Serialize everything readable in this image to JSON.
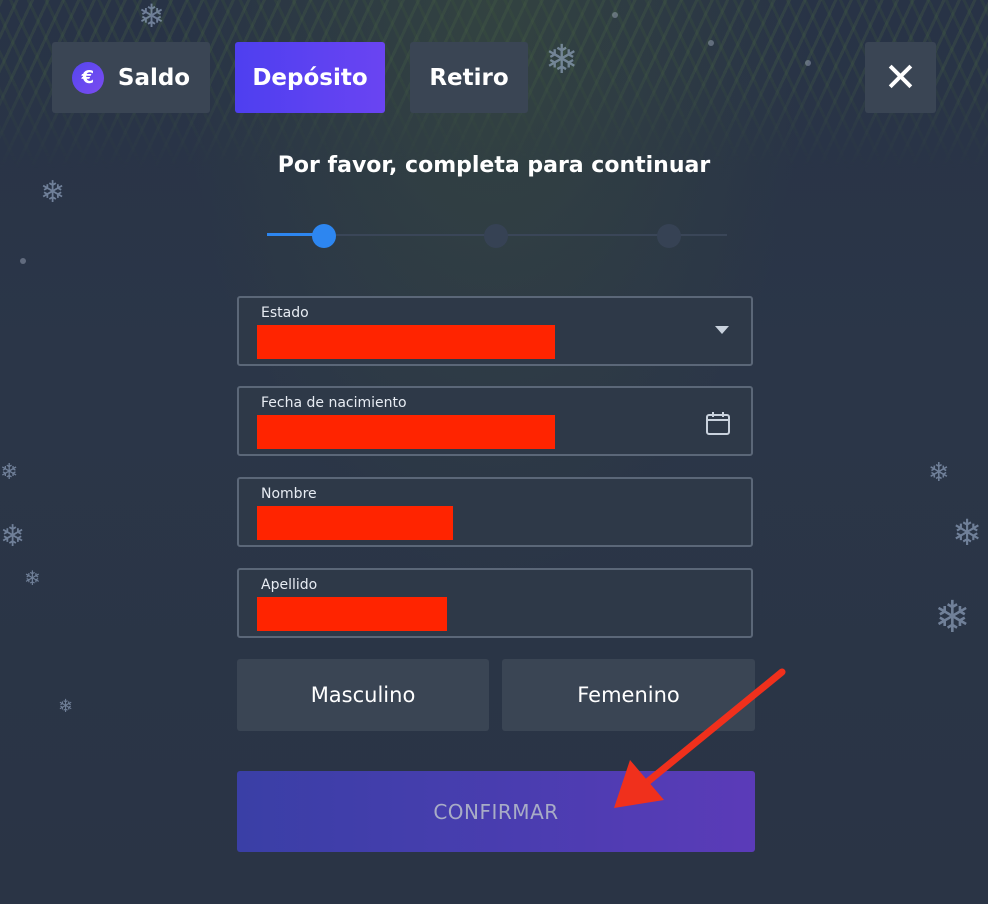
{
  "tabs": [
    {
      "label": "Saldo",
      "icon": "euro-icon",
      "active": false
    },
    {
      "label": "Depósito",
      "active": true
    },
    {
      "label": "Retiro",
      "active": false
    }
  ],
  "euro_symbol": "€",
  "close_symbol": "✕",
  "title": "Por favor, completa para continuar",
  "progress": {
    "current_step": 1,
    "total_steps": 3
  },
  "fields": {
    "estado": {
      "label": "Estado",
      "value": "[redacted]",
      "type": "select"
    },
    "fecha": {
      "label": "Fecha de nacimiento",
      "value": "[redacted]",
      "type": "date"
    },
    "nombre": {
      "label": "Nombre",
      "value": "[redacted]",
      "type": "text"
    },
    "apellido": {
      "label": "Apellido",
      "value": "[redacted]",
      "type": "text"
    }
  },
  "gender": {
    "male": "Masculino",
    "female": "Femenino"
  },
  "confirm_label": "CONFIRMAR",
  "colors": {
    "accent": "#5546ef",
    "progress": "#2d86f0",
    "redaction": "#ff2400",
    "annotation_arrow": "#f0301c"
  }
}
